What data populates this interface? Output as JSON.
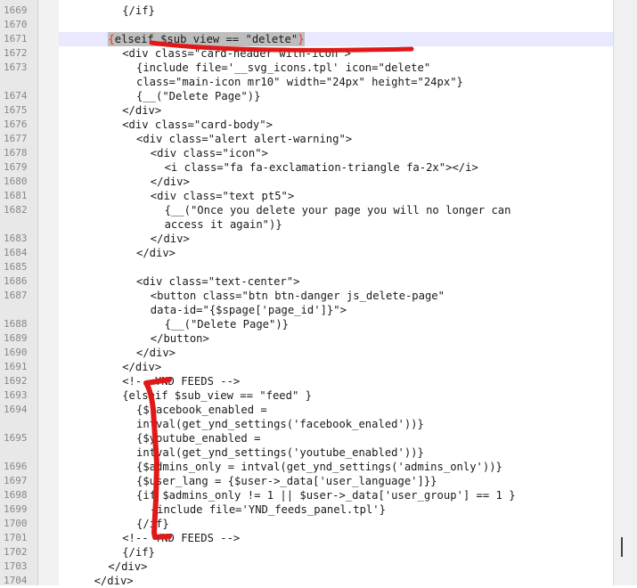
{
  "editor": {
    "lines": [
      {
        "n": "1669",
        "text": "{/if}",
        "indent": 8
      },
      {
        "n": "1670",
        "text": "",
        "indent": 0
      },
      {
        "n": "1671",
        "text": "{elseif $sub_view == \"delete\"}",
        "indent": 6,
        "current": true,
        "selected": true
      },
      {
        "n": "1672",
        "text": "<div class=\"card-header with-icon\">",
        "indent": 8
      },
      {
        "n": "1673",
        "text": "{include file='__svg_icons.tpl' icon=\"delete\"",
        "indent": 10
      },
      {
        "n": "",
        "text": "class=\"main-icon mr10\" width=\"24px\" height=\"24px\"}",
        "indent": 10
      },
      {
        "n": "1674",
        "text": "{__(\"Delete Page\")}",
        "indent": 10
      },
      {
        "n": "1675",
        "text": "</div>",
        "indent": 8
      },
      {
        "n": "1676",
        "text": "<div class=\"card-body\">",
        "indent": 8
      },
      {
        "n": "1677",
        "text": "<div class=\"alert alert-warning\">",
        "indent": 10
      },
      {
        "n": "1678",
        "text": "<div class=\"icon\">",
        "indent": 12
      },
      {
        "n": "1679",
        "text": "<i class=\"fa fa-exclamation-triangle fa-2x\"></i>",
        "indent": 14
      },
      {
        "n": "1680",
        "text": "</div>",
        "indent": 12
      },
      {
        "n": "1681",
        "text": "<div class=\"text pt5\">",
        "indent": 12
      },
      {
        "n": "1682",
        "text": "{__(\"Once you delete your page you will no longer can",
        "indent": 14
      },
      {
        "n": "",
        "text": "access it again\")}",
        "indent": 14
      },
      {
        "n": "1683",
        "text": "</div>",
        "indent": 12
      },
      {
        "n": "1684",
        "text": "</div>",
        "indent": 10
      },
      {
        "n": "1685",
        "text": "",
        "indent": 0
      },
      {
        "n": "1686",
        "text": "<div class=\"text-center\">",
        "indent": 10
      },
      {
        "n": "1687",
        "text": "<button class=\"btn btn-danger js_delete-page\"",
        "indent": 12
      },
      {
        "n": "",
        "text": "data-id=\"{$spage['page_id']}\">",
        "indent": 12
      },
      {
        "n": "1688",
        "text": "{__(\"Delete Page\")}",
        "indent": 14
      },
      {
        "n": "1689",
        "text": "</button>",
        "indent": 12
      },
      {
        "n": "1690",
        "text": "</div>",
        "indent": 10
      },
      {
        "n": "1691",
        "text": "</div>",
        "indent": 8
      },
      {
        "n": "1692",
        "text": "<!-- YND FEEDS -->",
        "indent": 8
      },
      {
        "n": "1693",
        "text": "{elseif $sub_view == \"feed\" }",
        "indent": 8
      },
      {
        "n": "1694",
        "text": "{$facebook_enabled =",
        "indent": 10
      },
      {
        "n": "",
        "text": "intval(get_ynd_settings('facebook_enaled'))}",
        "indent": 10
      },
      {
        "n": "1695",
        "text": "{$youtube_enabled =",
        "indent": 10
      },
      {
        "n": "",
        "text": "intval(get_ynd_settings('youtube_enabled'))}",
        "indent": 10
      },
      {
        "n": "1696",
        "text": "{$admins_only = intval(get_ynd_settings('admins_only'))}",
        "indent": 10
      },
      {
        "n": "1697",
        "text": "{$user_lang = {$user->_data['user_language']}}",
        "indent": 10
      },
      {
        "n": "1698",
        "text": "{if $admins_only != 1 || $user->_data['user_group'] == 1 }",
        "indent": 10
      },
      {
        "n": "1699",
        "text": "{include file='YND_feeds_panel.tpl'}",
        "indent": 12
      },
      {
        "n": "1700",
        "text": "{/if}",
        "indent": 10
      },
      {
        "n": "1701",
        "text": "<!-- YND FEEDS -->",
        "indent": 8
      },
      {
        "n": "1702",
        "text": "{/if}",
        "indent": 8
      },
      {
        "n": "1703",
        "text": "</div>",
        "indent": 6
      },
      {
        "n": "1704",
        "text": "</div>",
        "indent": 4
      }
    ],
    "annotation_color": "#e01818",
    "current_line_color": "#e8e8ff",
    "bracket_color": "#ff2a2a"
  }
}
